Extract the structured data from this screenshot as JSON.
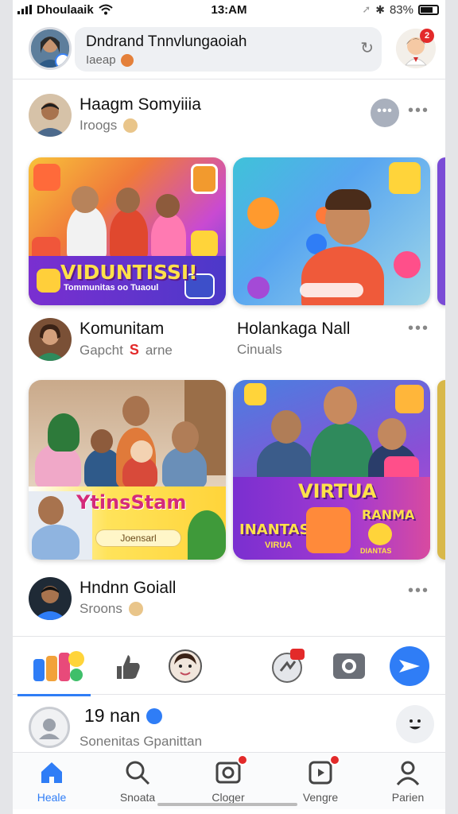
{
  "status_bar": {
    "carrier": "Dhoulaaik",
    "time": "13:AM",
    "battery": "83%"
  },
  "header": {
    "search_title": "Dndrand Tnnvlungaoiah",
    "search_sub": "Iaeap"
  },
  "groups": [
    {
      "name": "Haagm Somyiiia",
      "sub": "Iroogs"
    },
    {
      "name": "Komunitam",
      "sub": "Gapcht",
      "sub_extra": "arne"
    },
    {
      "name": "Holankaga Nall",
      "sub": "Cinuals"
    },
    {
      "name": "Hndnn Goiall",
      "sub": "Sroons"
    }
  ],
  "cards": [
    {
      "banner": "VIDUNTISSI!",
      "caption": "Tommunitas oo Tuaoul"
    },
    {
      "pill": ""
    },
    {
      "banner": "YtinsStam",
      "caption": "Joensarl"
    },
    {
      "banner": "VIRTUA",
      "banner2": "INANTAS",
      "banner2_sub": "VIRUA",
      "banner3": "RANMA",
      "banner3_sub": "DIANTAS"
    }
  ],
  "post": {
    "title": "19 nan",
    "sub": "Sonenitas Gpanittan"
  },
  "bottom_nav": [
    {
      "label": "Heale",
      "icon": "home-icon",
      "active": true
    },
    {
      "label": "Snoata",
      "icon": "search-icon"
    },
    {
      "label": "Cloger",
      "icon": "camera-icon"
    },
    {
      "label": "Vengre",
      "icon": "video-icon"
    },
    {
      "label": "Parien",
      "icon": "profile-icon"
    }
  ],
  "toolbar": {
    "message_badge": ""
  },
  "colors": {
    "accent": "#2f7df6",
    "badge": "#e32a2a",
    "banner_yellow": "#ffe14a",
    "banner_purple": "#6b2bb8"
  }
}
